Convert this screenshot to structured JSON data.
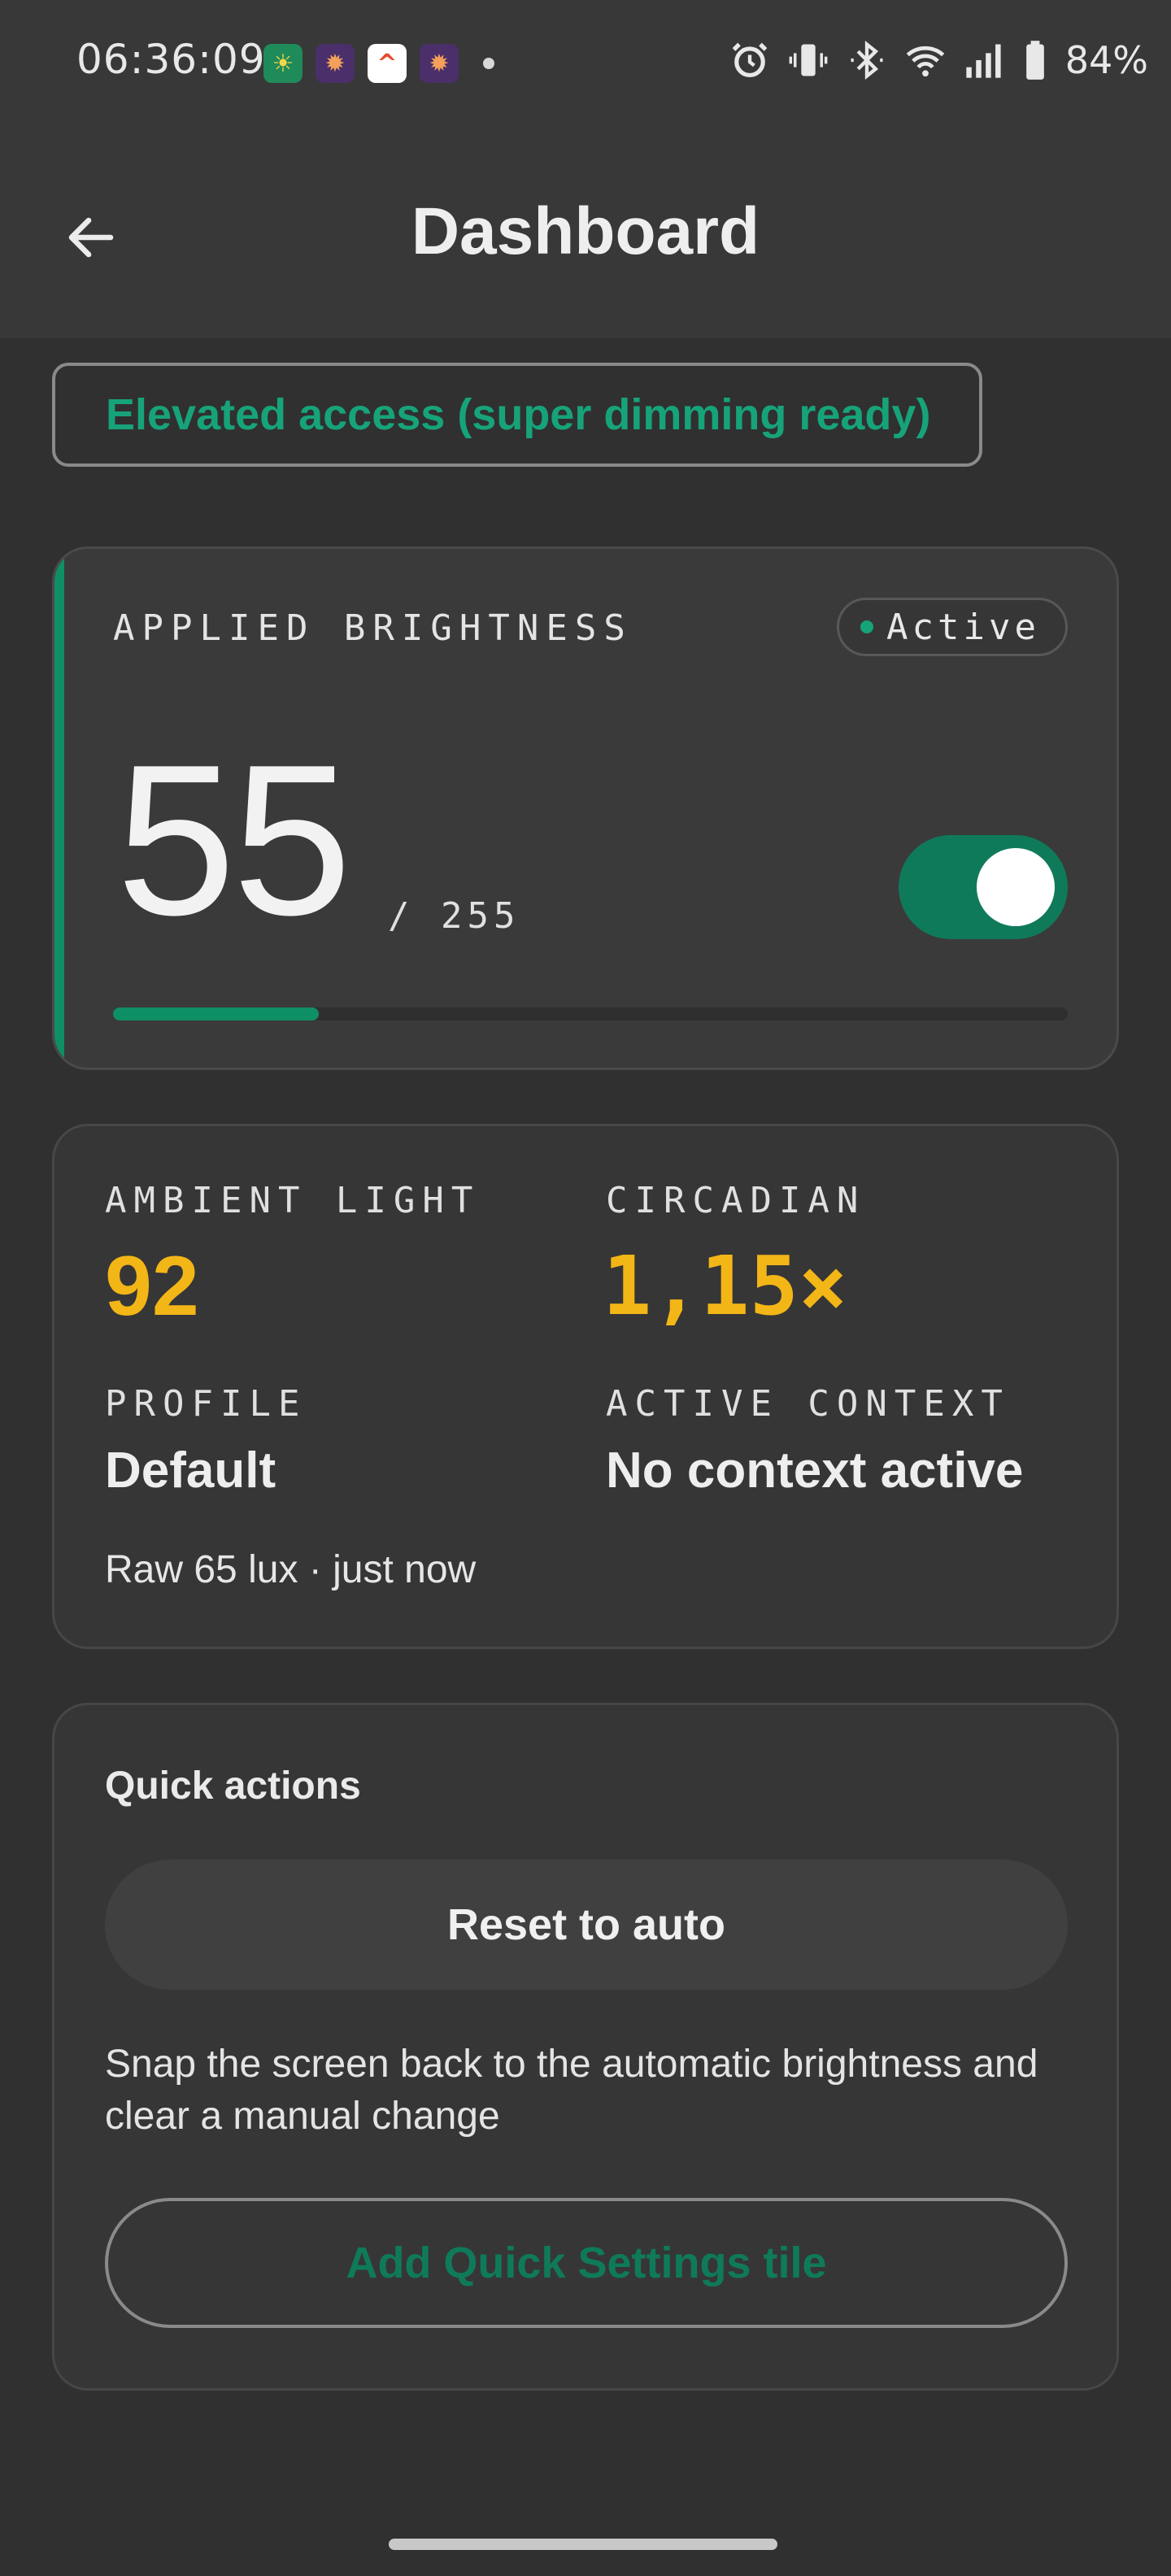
{
  "status_bar": {
    "time": "06:36:09",
    "notification_icons": [
      "sun-app-icon",
      "bug-app-icon",
      "arrow-app-icon",
      "bug-app-icon"
    ],
    "battery": "84%"
  },
  "app_bar": {
    "title": "Dashboard"
  },
  "elevated_badge": {
    "label": "Elevated access (super dimming ready)"
  },
  "brightness": {
    "label": "APPLIED BRIGHTNESS",
    "status_chip": "Active",
    "value": "55",
    "max": "/ 255",
    "toggle_on": true,
    "level_fraction": 0.2157
  },
  "stats": {
    "ambient_label": "AMBIENT LIGHT",
    "ambient_value": "92",
    "circadian_label": "CIRCADIAN",
    "circadian_value": "1,15×",
    "profile_label": "PROFILE",
    "profile_value": "Default",
    "context_label": "ACTIVE CONTEXT",
    "context_value": "No context active",
    "raw": "Raw 65 lux · just now"
  },
  "quick_actions": {
    "title": "Quick actions",
    "reset_label": "Reset to auto",
    "description": "Snap the screen back to the automatic brightness and clear a manual change",
    "tile_label": "Add Quick Settings tile"
  },
  "colors": {
    "accent_green": "#0f8f66",
    "amber": "#f3b617",
    "background": "#303030"
  }
}
